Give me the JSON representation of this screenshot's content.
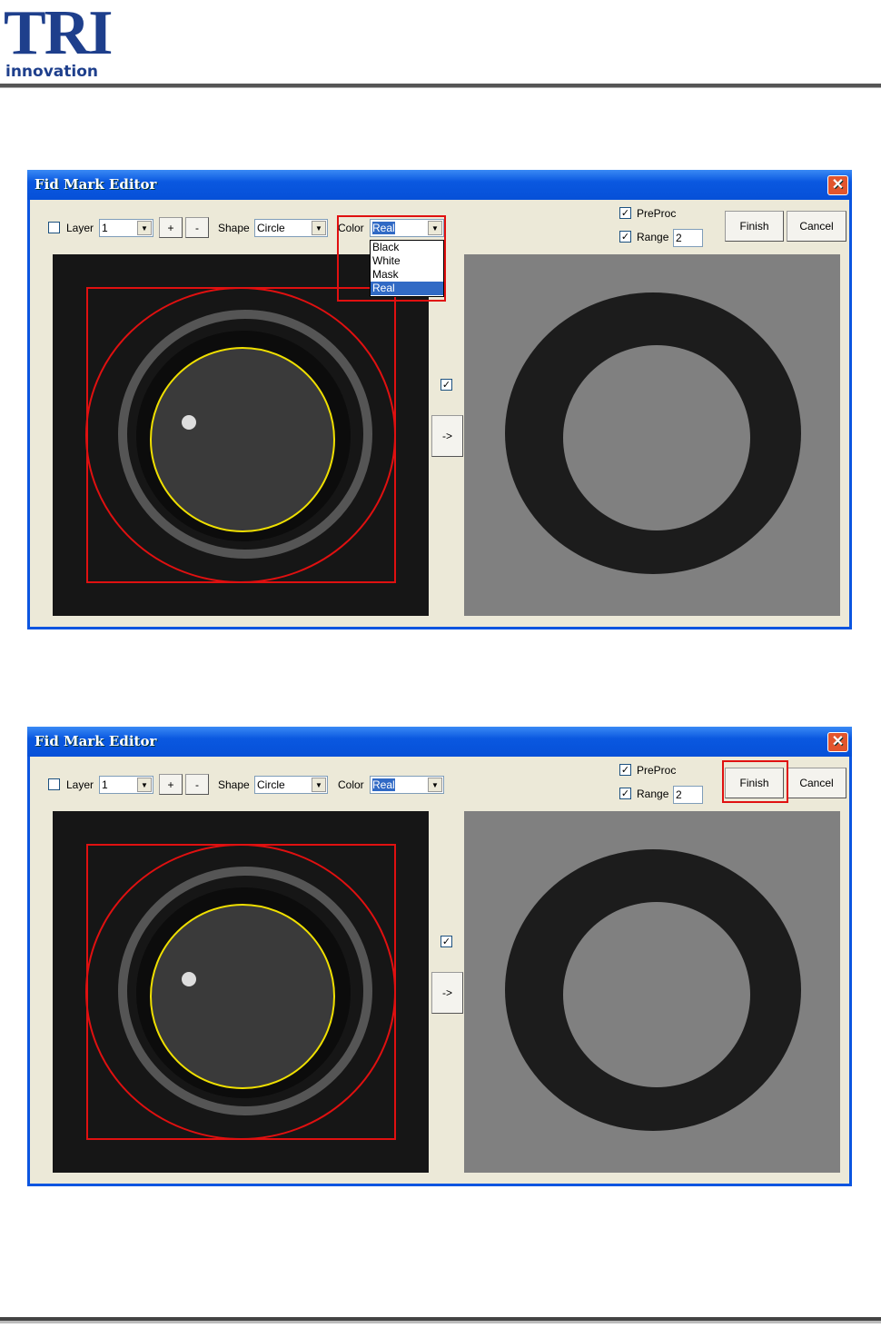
{
  "logo": {
    "text": "TRI",
    "subtitle": "innovation"
  },
  "dialogs": [
    {
      "title": "Fid Mark Editor",
      "layer_label": "Layer",
      "layer_value": "1",
      "plus": "+",
      "minus": "-",
      "shape_label": "Shape",
      "shape_value": "Circle",
      "color_label": "Color",
      "color_value": "Real",
      "preproc_label": "PreProc",
      "range_label": "Range",
      "range_value": "2",
      "finish": "Finish",
      "cancel": "Cancel",
      "arrow": "->",
      "color_options": [
        "Black",
        "White",
        "Mask",
        "Real"
      ],
      "dropdown_open": true,
      "highlight": "color"
    },
    {
      "title": "Fid Mark Editor",
      "layer_label": "Layer",
      "layer_value": "1",
      "plus": "+",
      "minus": "-",
      "shape_label": "Shape",
      "shape_value": "Circle",
      "color_label": "Color",
      "color_value": "Real",
      "preproc_label": "PreProc",
      "range_label": "Range",
      "range_value": "2",
      "finish": "Finish",
      "cancel": "Cancel",
      "arrow": "->",
      "dropdown_open": false,
      "highlight": "finish"
    }
  ],
  "colors": {
    "titlebar": "#0a58e0",
    "highlight": "#e01010",
    "mark_yellow": "#f0e000"
  }
}
